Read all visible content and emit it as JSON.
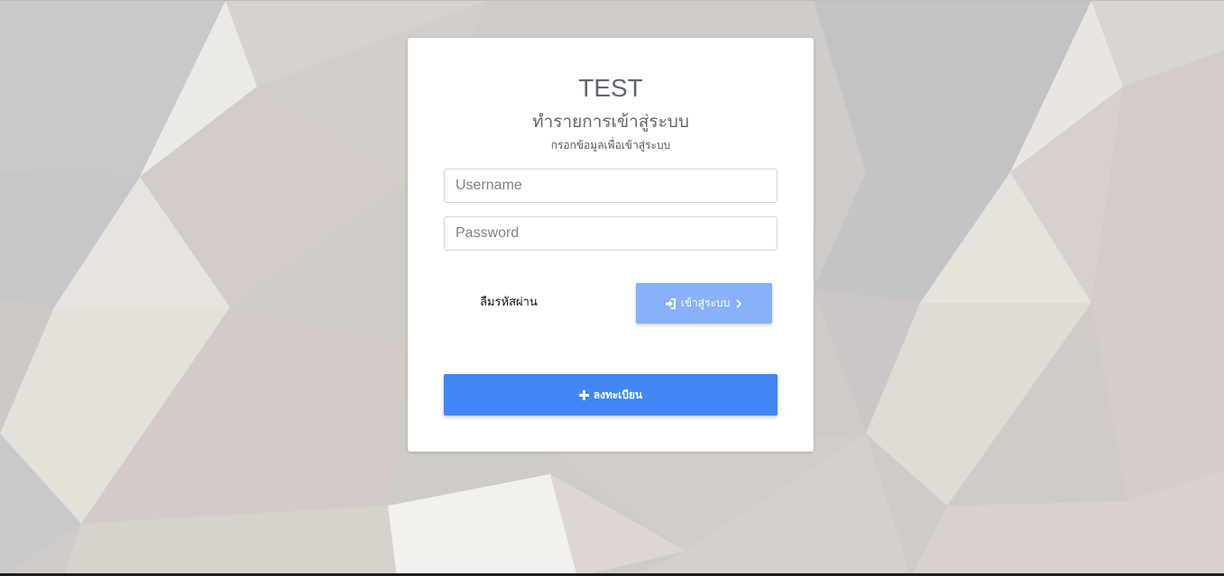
{
  "app": {
    "title": "TEST",
    "subtitle": "ทำรายการเข้าสู่ระบบ",
    "hint": "กรอกข้อมูลเพื่อเข้าสู่ระบบ"
  },
  "form": {
    "username": {
      "placeholder": "Username",
      "value": ""
    },
    "password": {
      "placeholder": "Password",
      "value": ""
    },
    "forgot_label": "ลืมรหัสผ่าน",
    "login_label": "เข้าสู่ระบบ",
    "register_label": "ลงทะเบียน"
  },
  "icons": {
    "login": "sign-in-icon",
    "login_arrow": "chevron-right-icon",
    "register": "plus-icon"
  },
  "colors": {
    "login_button": "#86b1f7",
    "register_button": "#4286f4",
    "card": "#ffffff"
  }
}
